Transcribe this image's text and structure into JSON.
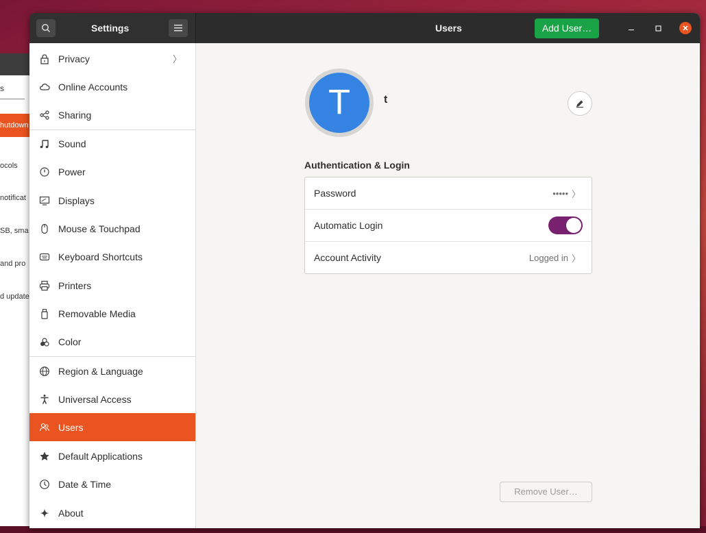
{
  "background_window": {
    "search_fragment": "s",
    "selected_item": "hutdown",
    "items": [
      "ocols",
      "notificat",
      "SB, sma",
      "and pro",
      "d update"
    ]
  },
  "titlebar": {
    "app_title": "Settings",
    "page_title": "Users",
    "add_user_label": "Add User…",
    "accent_color": "#19a346"
  },
  "sidebar": {
    "active_color": "#e95420",
    "items": [
      {
        "label": "Privacy",
        "icon": "lock-icon"
      },
      {
        "label": "Online Accounts",
        "icon": "cloud-icon"
      },
      {
        "label": "Sharing",
        "icon": "share-icon"
      },
      {
        "label": "Sound",
        "icon": "music-note-icon"
      },
      {
        "label": "Power",
        "icon": "power-icon"
      },
      {
        "label": "Displays",
        "icon": "display-icon"
      },
      {
        "label": "Mouse & Touchpad",
        "icon": "mouse-icon"
      },
      {
        "label": "Keyboard Shortcuts",
        "icon": "keyboard-icon"
      },
      {
        "label": "Printers",
        "icon": "printer-icon"
      },
      {
        "label": "Removable Media",
        "icon": "usb-drive-icon"
      },
      {
        "label": "Color",
        "icon": "color-icon"
      },
      {
        "label": "Region & Language",
        "icon": "globe-icon"
      },
      {
        "label": "Universal Access",
        "icon": "accessibility-icon"
      },
      {
        "label": "Users",
        "icon": "users-icon"
      },
      {
        "label": "Default Applications",
        "icon": "star-icon"
      },
      {
        "label": "Date & Time",
        "icon": "clock-icon"
      },
      {
        "label": "About",
        "icon": "sparkle-icon"
      }
    ]
  },
  "user": {
    "avatar_letter": "T",
    "name": "t",
    "avatar_color": "#3584e4"
  },
  "auth": {
    "section_title": "Authentication & Login",
    "password_label": "Password",
    "password_value": "•••••",
    "autologin_label": "Automatic Login",
    "autologin_enabled": true,
    "activity_label": "Account Activity",
    "activity_value": "Logged in"
  },
  "remove_user_label": "Remove User…"
}
